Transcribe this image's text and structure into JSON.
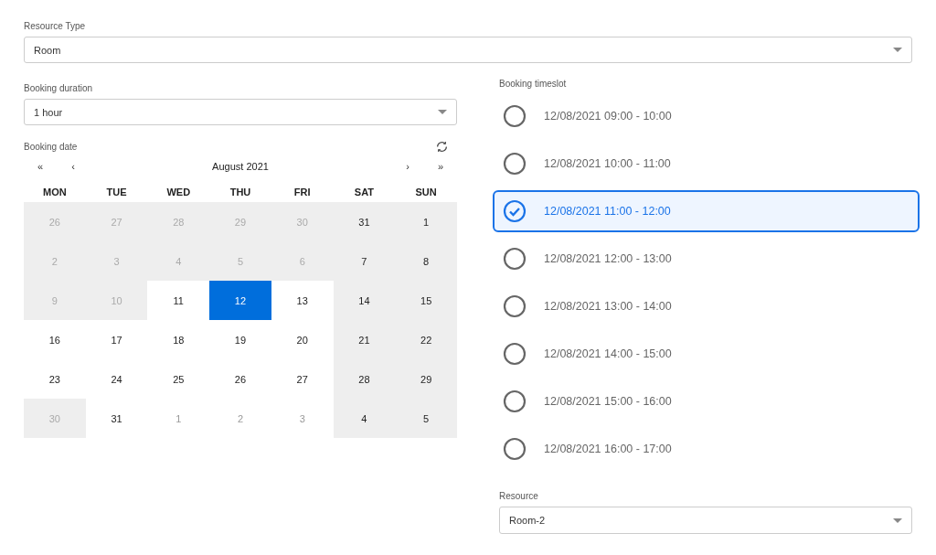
{
  "resource_type": {
    "label": "Resource Type",
    "value": "Room"
  },
  "booking_duration": {
    "label": "Booking duration",
    "value": "1 hour"
  },
  "booking_date": {
    "label": "Booking date",
    "month": "August 2021",
    "nav": {
      "prev_year": "«",
      "prev_month": "‹",
      "next_month": "›",
      "next_year": "»"
    },
    "weekdays": [
      "MON",
      "TUE",
      "WED",
      "THU",
      "FRI",
      "SAT",
      "SUN"
    ],
    "days": [
      {
        "text": "26",
        "kind": "disabled"
      },
      {
        "text": "27",
        "kind": "disabled"
      },
      {
        "text": "28",
        "kind": "disabled"
      },
      {
        "text": "29",
        "kind": "disabled"
      },
      {
        "text": "30",
        "kind": "disabled"
      },
      {
        "text": "31",
        "kind": "weekend"
      },
      {
        "text": "1",
        "kind": "weekend"
      },
      {
        "text": "2",
        "kind": "disabled"
      },
      {
        "text": "3",
        "kind": "disabled"
      },
      {
        "text": "4",
        "kind": "disabled"
      },
      {
        "text": "5",
        "kind": "disabled"
      },
      {
        "text": "6",
        "kind": "disabled"
      },
      {
        "text": "7",
        "kind": "weekend"
      },
      {
        "text": "8",
        "kind": "weekend"
      },
      {
        "text": "9",
        "kind": "disabled"
      },
      {
        "text": "10",
        "kind": "disabled"
      },
      {
        "text": "11",
        "kind": "normal"
      },
      {
        "text": "12",
        "kind": "selected"
      },
      {
        "text": "13",
        "kind": "normal"
      },
      {
        "text": "14",
        "kind": "weekend"
      },
      {
        "text": "15",
        "kind": "weekend"
      },
      {
        "text": "16",
        "kind": "normal"
      },
      {
        "text": "17",
        "kind": "normal"
      },
      {
        "text": "18",
        "kind": "normal"
      },
      {
        "text": "19",
        "kind": "normal"
      },
      {
        "text": "20",
        "kind": "normal"
      },
      {
        "text": "21",
        "kind": "weekend"
      },
      {
        "text": "22",
        "kind": "weekend"
      },
      {
        "text": "23",
        "kind": "normal"
      },
      {
        "text": "24",
        "kind": "normal"
      },
      {
        "text": "25",
        "kind": "normal"
      },
      {
        "text": "26",
        "kind": "normal"
      },
      {
        "text": "27",
        "kind": "normal"
      },
      {
        "text": "28",
        "kind": "weekend"
      },
      {
        "text": "29",
        "kind": "weekend"
      },
      {
        "text": "30",
        "kind": "disabled"
      },
      {
        "text": "31",
        "kind": "normal"
      },
      {
        "text": "1",
        "kind": "neighbor"
      },
      {
        "text": "2",
        "kind": "neighbor"
      },
      {
        "text": "3",
        "kind": "neighbor"
      },
      {
        "text": "4",
        "kind": "weekend"
      },
      {
        "text": "5",
        "kind": "weekend"
      }
    ]
  },
  "booking_timeslot": {
    "label": "Booking timeslot",
    "slots": [
      {
        "text": "12/08/2021 09:00 - 10:00",
        "selected": false
      },
      {
        "text": "12/08/2021 10:00 - 11:00",
        "selected": false
      },
      {
        "text": "12/08/2021 11:00 - 12:00",
        "selected": true
      },
      {
        "text": "12/08/2021 12:00 - 13:00",
        "selected": false
      },
      {
        "text": "12/08/2021 13:00 - 14:00",
        "selected": false
      },
      {
        "text": "12/08/2021 14:00 - 15:00",
        "selected": false
      },
      {
        "text": "12/08/2021 15:00 - 16:00",
        "selected": false
      },
      {
        "text": "12/08/2021 16:00 - 17:00",
        "selected": false
      }
    ]
  },
  "resource": {
    "label": "Resource",
    "value": "Room-2"
  }
}
